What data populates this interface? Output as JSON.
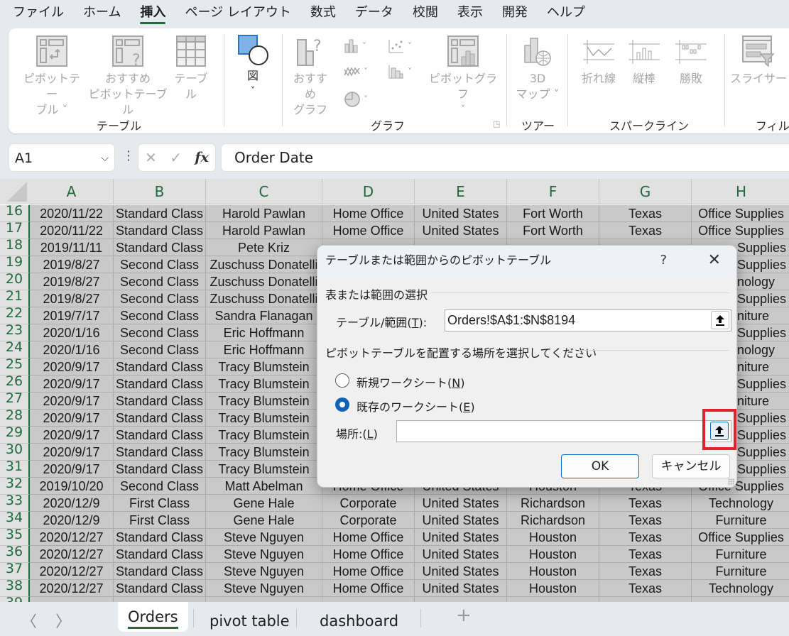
{
  "menu": {
    "tabs": [
      {
        "label": "ファイル",
        "active": false
      },
      {
        "label": "ホーム",
        "active": false
      },
      {
        "label": "挿入",
        "active": true
      },
      {
        "label": "ページ レイアウト",
        "active": false
      },
      {
        "label": "数式",
        "active": false
      },
      {
        "label": "データ",
        "active": false
      },
      {
        "label": "校閲",
        "active": false
      },
      {
        "label": "表示",
        "active": false
      },
      {
        "label": "開発",
        "active": false
      },
      {
        "label": "ヘルプ",
        "active": false
      }
    ]
  },
  "ribbon": {
    "groups": {
      "table": {
        "label": "テーブル",
        "pivot_table": {
          "line1": "ピボットテー",
          "line2": "ブル ˅"
        },
        "recommended_pivot": {
          "line1": "おすすめ",
          "line2": "ピボットテーブル"
        },
        "table": {
          "line1": "テーブル"
        }
      },
      "illustrations": {
        "shapes": {
          "line1": "図",
          "line2": "˅"
        }
      },
      "charts": {
        "label": "グラフ",
        "recommended_charts": {
          "line1": "おすすめ",
          "line2": "グラフ"
        },
        "pivot_chart": {
          "line1": "ピボットグラフ",
          "line2": "˅"
        }
      },
      "tours": {
        "label": "ツアー",
        "map3d": {
          "line1": "3D",
          "line2": "マップ ˅"
        }
      },
      "sparklines": {
        "label": "スパークライン",
        "line": "折れ線",
        "column": "縦棒",
        "winloss": "勝敗"
      },
      "filters": {
        "label": "フィルタ",
        "slicer": "スライサー"
      }
    }
  },
  "formula_bar": {
    "name_box": "A1",
    "formula": "Order Date"
  },
  "grid": {
    "columns": [
      "A",
      "B",
      "C",
      "D",
      "E",
      "F",
      "G",
      "H"
    ],
    "rows": [
      {
        "num": "16",
        "cells": [
          "2020/11/22",
          "Standard Class",
          "Harold Pawlan",
          "Home Office",
          "United States",
          "Fort Worth",
          "Texas",
          "Office Supplies"
        ]
      },
      {
        "num": "17",
        "cells": [
          "2020/11/22",
          "Standard Class",
          "Harold Pawlan",
          "Home Office",
          "United States",
          "Fort Worth",
          "Texas",
          "Office Supplies"
        ]
      },
      {
        "num": "18",
        "cells": [
          "2019/11/11",
          "Standard Class",
          "Pete Kriz",
          "",
          "",
          "",
          "",
          "Supplies"
        ]
      },
      {
        "num": "19",
        "cells": [
          "2019/8/27",
          "Second Class",
          "Zuschuss Donatelli",
          "",
          "",
          "",
          "",
          "Supplies"
        ]
      },
      {
        "num": "20",
        "cells": [
          "2019/8/27",
          "Second Class",
          "Zuschuss Donatelli",
          "",
          "",
          "",
          "",
          "nology"
        ]
      },
      {
        "num": "21",
        "cells": [
          "2019/8/27",
          "Second Class",
          "Zuschuss Donatelli",
          "",
          "",
          "",
          "",
          "Supplies"
        ]
      },
      {
        "num": "22",
        "cells": [
          "2019/7/17",
          "Second Class",
          "Sandra Flanagan",
          "",
          "",
          "",
          "",
          "niture"
        ]
      },
      {
        "num": "23",
        "cells": [
          "2020/1/16",
          "Second Class",
          "Eric Hoffmann",
          "",
          "",
          "",
          "",
          "Supplies"
        ]
      },
      {
        "num": "24",
        "cells": [
          "2020/1/16",
          "Second Class",
          "Eric Hoffmann",
          "",
          "",
          "",
          "",
          "nology"
        ]
      },
      {
        "num": "25",
        "cells": [
          "2020/9/17",
          "Standard Class",
          "Tracy Blumstein",
          "",
          "",
          "",
          "",
          "niture"
        ]
      },
      {
        "num": "26",
        "cells": [
          "2020/9/17",
          "Standard Class",
          "Tracy Blumstein",
          "",
          "",
          "",
          "",
          "Supplies"
        ]
      },
      {
        "num": "27",
        "cells": [
          "2020/9/17",
          "Standard Class",
          "Tracy Blumstein",
          "",
          "",
          "",
          "",
          "niture"
        ]
      },
      {
        "num": "28",
        "cells": [
          "2020/9/17",
          "Standard Class",
          "Tracy Blumstein",
          "",
          "",
          "",
          "",
          "Supplies"
        ]
      },
      {
        "num": "29",
        "cells": [
          "2020/9/17",
          "Standard Class",
          "Tracy Blumstein",
          "",
          "",
          "",
          "",
          "Supplies"
        ]
      },
      {
        "num": "30",
        "cells": [
          "2020/9/17",
          "Standard Class",
          "Tracy Blumstein",
          "",
          "",
          "",
          "",
          "Supplies"
        ]
      },
      {
        "num": "31",
        "cells": [
          "2020/9/17",
          "Standard Class",
          "Tracy Blumstein",
          "",
          "",
          "",
          "",
          "Supplies"
        ]
      },
      {
        "num": "32",
        "cells": [
          "2019/10/20",
          "Second Class",
          "Matt Abelman",
          "Home Office",
          "United States",
          "Houston",
          "Texas",
          "Office Supplies"
        ]
      },
      {
        "num": "33",
        "cells": [
          "2020/12/9",
          "First Class",
          "Gene Hale",
          "Corporate",
          "United States",
          "Richardson",
          "Texas",
          "Technology"
        ]
      },
      {
        "num": "34",
        "cells": [
          "2020/12/9",
          "First Class",
          "Gene Hale",
          "Corporate",
          "United States",
          "Richardson",
          "Texas",
          "Furniture"
        ]
      },
      {
        "num": "35",
        "cells": [
          "2020/12/27",
          "Standard Class",
          "Steve Nguyen",
          "Home Office",
          "United States",
          "Houston",
          "Texas",
          "Office Supplies"
        ]
      },
      {
        "num": "36",
        "cells": [
          "2020/12/27",
          "Standard Class",
          "Steve Nguyen",
          "Home Office",
          "United States",
          "Houston",
          "Texas",
          "Furniture"
        ]
      },
      {
        "num": "37",
        "cells": [
          "2020/12/27",
          "Standard Class",
          "Steve Nguyen",
          "Home Office",
          "United States",
          "Houston",
          "Texas",
          "Furniture"
        ]
      },
      {
        "num": "38",
        "cells": [
          "2020/12/27",
          "Standard Class",
          "Steve Nguyen",
          "Home Office",
          "United States",
          "Houston",
          "Texas",
          "Technology"
        ]
      },
      {
        "num": "39",
        "cells": [
          "",
          "",
          "",
          "",
          "",
          "",
          "",
          ""
        ]
      }
    ]
  },
  "sheets": {
    "tabs": [
      {
        "label": "Orders",
        "active": true
      },
      {
        "label": "pivot table",
        "active": false
      },
      {
        "label": "dashboard",
        "active": false
      }
    ],
    "add_label": "+",
    "prev_label": "〈",
    "next_label": "〉"
  },
  "dialog": {
    "title": "テーブルまたは範囲からのピボットテーブル",
    "help": "?",
    "close": "✕",
    "section1": "表または範囲の選択",
    "range_label_pre": "テーブル/範囲(",
    "range_label_key": "T",
    "range_label_post": "):",
    "range_value": "Orders!$A$1:$N$8194",
    "section2": "ピボットテーブルを配置する場所を選択してください",
    "radio_new_pre": "新規ワークシート(",
    "radio_new_key": "N",
    "radio_new_post": ")",
    "radio_new_checked": false,
    "radio_existing_pre": "既存のワークシート(",
    "radio_existing_key": "E",
    "radio_existing_post": ")",
    "radio_existing_checked": true,
    "location_label_pre": "場所:(",
    "location_label_key": "L",
    "location_label_post": ")",
    "location_value": "",
    "ok": "OK",
    "cancel": "キャンセル"
  },
  "colors": {
    "accent_green": "#1e6b3c",
    "radio_blue": "#0f62b6",
    "highlight_red": "#e3202b"
  }
}
